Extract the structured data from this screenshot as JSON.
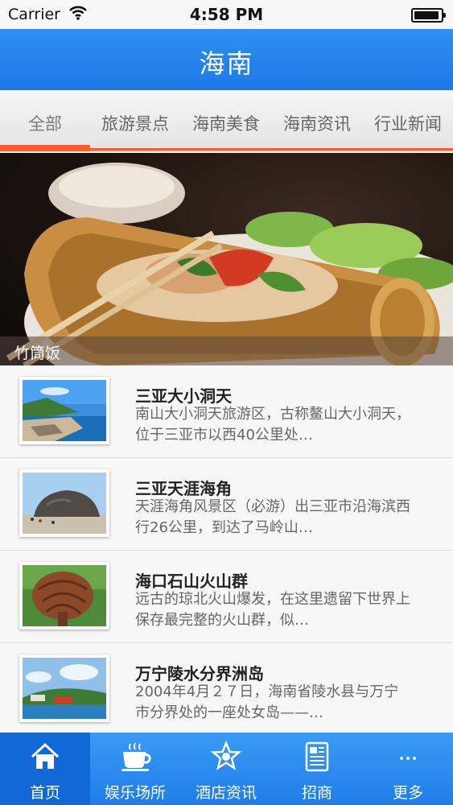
{
  "status_bar": {
    "carrier": "Carrier",
    "time": "4:58 PM"
  },
  "nav": {
    "title": "海南"
  },
  "tabs": [
    {
      "label": "全部",
      "active": true
    },
    {
      "label": "旅游景点"
    },
    {
      "label": "海南美食"
    },
    {
      "label": "海南资讯"
    },
    {
      "label": "行业新闻"
    }
  ],
  "hero": {
    "caption": "竹筒饭"
  },
  "list": [
    {
      "title": "三亚大小洞天",
      "desc": "南山大小洞天旅游区，古称鳌山大小洞天，位于三亚市以西40公里处…",
      "icon": "beach-photo"
    },
    {
      "title": "三亚天涯海角",
      "desc": "天涯海角风景区（必游）出三亚市沿海滨西行26公里，到达了马岭山…",
      "icon": "rock-photo"
    },
    {
      "title": "海口石山火山群",
      "desc": "远古的琼北火山爆发，在这里遗留下世界上保存最完整的火山群，似…",
      "icon": "tree-root-photo"
    },
    {
      "title": "万宁陵水分界洲岛",
      "desc": "2004年4月２７日，海南省陵水县与万宁市分界处的一座处女岛——…",
      "icon": "island-photo"
    }
  ],
  "tab_bar": [
    {
      "label": "首页",
      "icon": "home-icon",
      "active": true
    },
    {
      "label": "娱乐场所",
      "icon": "coffee-cup-icon"
    },
    {
      "label": "酒店资讯",
      "icon": "star-badge-icon"
    },
    {
      "label": "招商",
      "icon": "newspaper-icon"
    },
    {
      "label": "更多",
      "icon": "more-icon"
    }
  ],
  "colors": {
    "nav_blue": "#2d8ff1",
    "accent_orange": "#ff5a2a",
    "tab_bar_blue": "#2b8cf2"
  }
}
